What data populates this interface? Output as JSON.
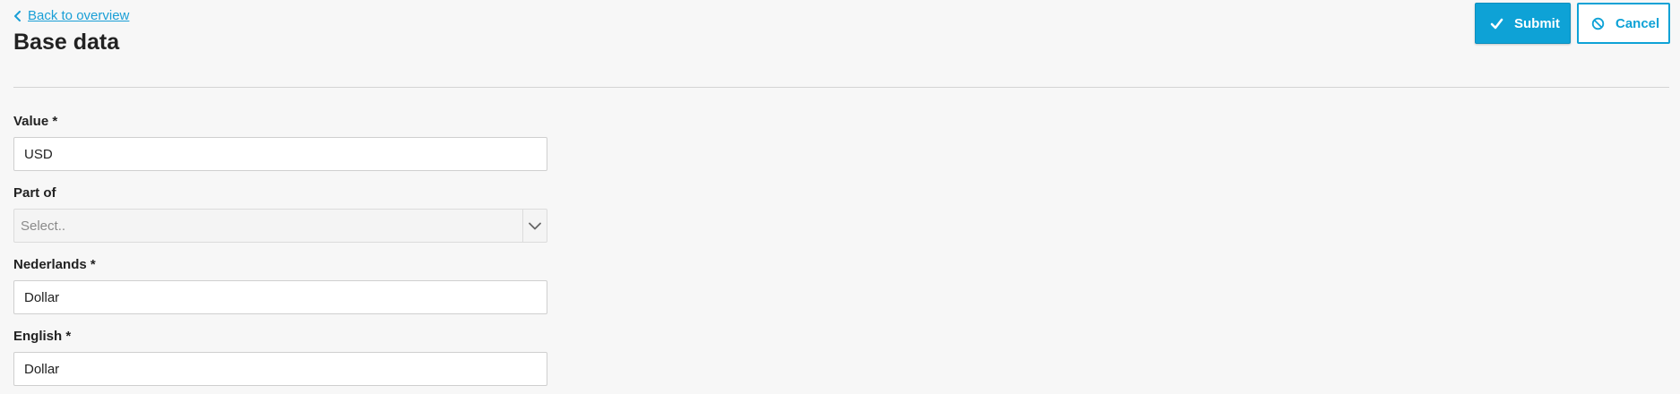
{
  "header": {
    "back_link_label": "Back to overview",
    "title": "Base data"
  },
  "actions": {
    "submit_label": "Submit",
    "cancel_label": "Cancel"
  },
  "form": {
    "value": {
      "label": "Value *",
      "value": "USD"
    },
    "part_of": {
      "label": "Part of",
      "placeholder": "Select.."
    },
    "nederlands": {
      "label": "Nederlands *",
      "value": "Dollar"
    },
    "english": {
      "label": "English *",
      "value": "Dollar"
    }
  },
  "icons": {
    "back": "chevron-left-icon",
    "submit": "check-icon",
    "cancel": "ban-icon",
    "select": "chevron-down-icon"
  },
  "colors": {
    "accent": "#0ea2d6",
    "background": "#f7f7f7"
  }
}
